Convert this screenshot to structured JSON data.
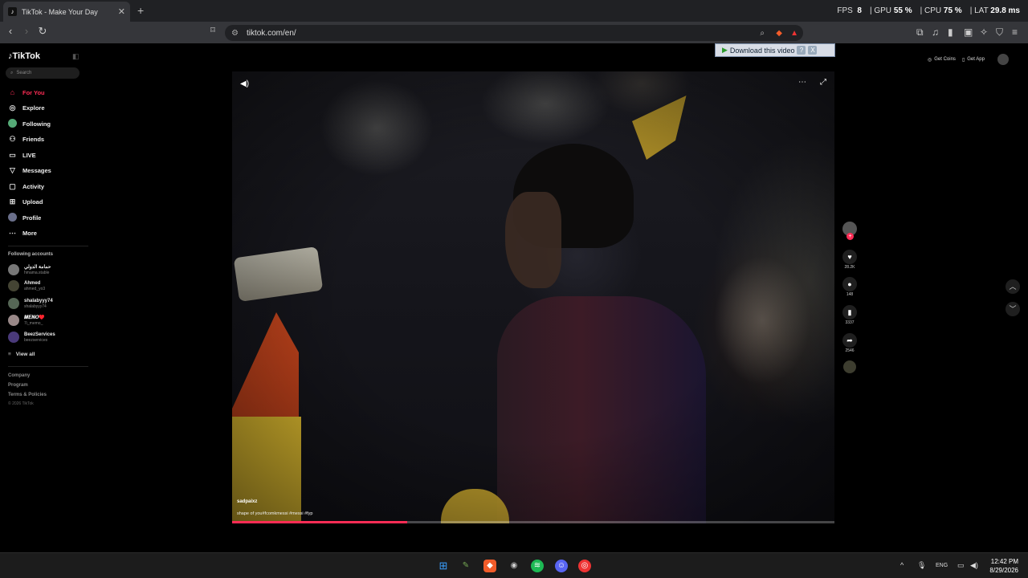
{
  "browser": {
    "tab_title": "TikTok - Make Your Day",
    "tab_close": "✕",
    "new_tab": "+",
    "url": "tiktok.com/en/",
    "perf": {
      "fps_label": "FPS",
      "fps": "8",
      "gpu_label": "GPU",
      "gpu": "55 %",
      "cpu_label": "CPU",
      "cpu": "75 %",
      "lat_label": "LAT",
      "lat": "29.8 ms"
    }
  },
  "download_banner": {
    "label": "Download this video",
    "help": "?",
    "close": "X"
  },
  "sidebar": {
    "logo": "TikTok",
    "search_placeholder": "Search",
    "nav": [
      {
        "label": "For You",
        "icon": "home-icon"
      },
      {
        "label": "Explore",
        "icon": "compass-icon"
      },
      {
        "label": "Following",
        "icon": "avatar"
      },
      {
        "label": "Friends",
        "icon": "friends-icon"
      },
      {
        "label": "LIVE",
        "icon": "live-icon"
      },
      {
        "label": "Messages",
        "icon": "send-icon"
      },
      {
        "label": "Activity",
        "icon": "inbox-icon"
      },
      {
        "label": "Upload",
        "icon": "plus-square-icon"
      },
      {
        "label": "Profile",
        "icon": "avatar"
      },
      {
        "label": "More",
        "icon": "more-icon"
      }
    ],
    "following_title": "Following accounts",
    "accounts": [
      {
        "name": "حمامة الدولي",
        "handle": "hmama.stable"
      },
      {
        "name": "Ahmed",
        "handle": "ahmed_yo3"
      },
      {
        "name": "shalabyyy74",
        "handle": "shalabyyy74"
      },
      {
        "name": "𝑴𝑬𝑵𝑶♥️",
        "handle": "7i_memo_"
      },
      {
        "name": "BeezServices",
        "handle": "beezservices"
      }
    ],
    "view_all": "View all",
    "footer": [
      "Company",
      "Program",
      "Terms & Policies"
    ],
    "copyright": "© 2026 TikTok"
  },
  "topright": {
    "get_coins": "Get Coins",
    "get_app": "Get App"
  },
  "video": {
    "username": "sadpaixz",
    "caption": "shape of you#fcomkmessi #messi #fyp",
    "progress": 0.29
  },
  "actions": {
    "likes": "28.2K",
    "comments": "148",
    "saves": "3337",
    "shares": "2546"
  },
  "taskbar": {
    "lang": "ENG",
    "time": "12:42 PM",
    "date": "8/29/2026"
  }
}
